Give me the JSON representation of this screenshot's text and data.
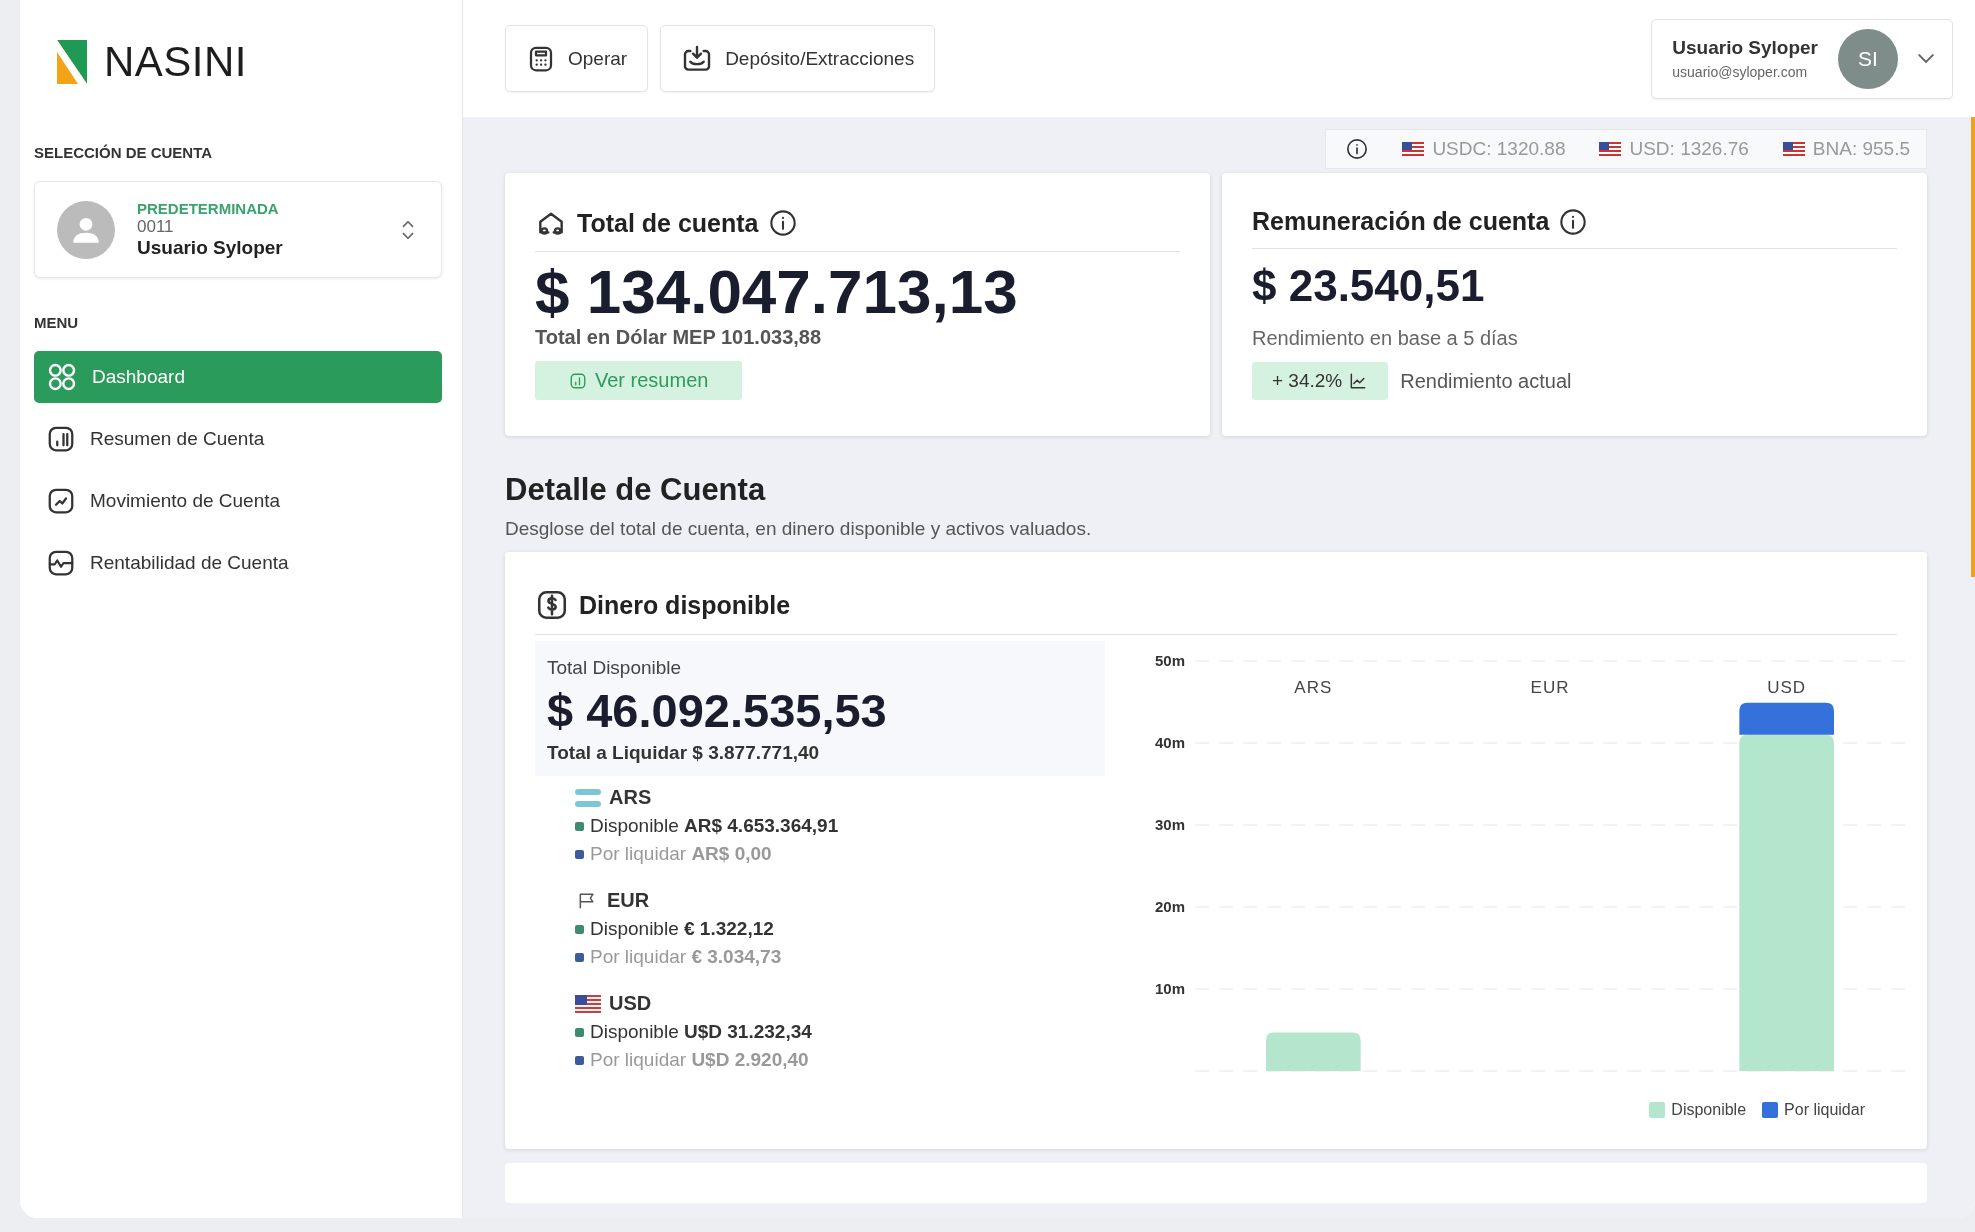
{
  "logo": {
    "text": "NASINI"
  },
  "account_selection": {
    "heading": "SELECCIÓN DE CUENTA",
    "badge": "PREDETERMINADA",
    "number": "0011",
    "name": "Usuario Syloper"
  },
  "menu": {
    "heading": "MENU",
    "items": [
      {
        "label": "Dashboard",
        "selected": true
      },
      {
        "label": "Resumen de Cuenta",
        "selected": false
      },
      {
        "label": "Movimiento de Cuenta",
        "selected": false
      },
      {
        "label": "Rentabilidad de Cuenta",
        "selected": false
      }
    ]
  },
  "toolbar": {
    "buttons": [
      "Operar",
      "Depósito/Extracciones"
    ]
  },
  "user": {
    "name": "Usuario Syloper",
    "email": "usuario@syloper.com",
    "initials": "SI"
  },
  "rates": [
    "USDC: 1320.88",
    "USD: 1326.76",
    "BNA: 955.5"
  ],
  "total_card": {
    "title": "Total de cuenta",
    "amount": "$ 134.047.713,13",
    "subtitle": "Total en Dólar MEP 101.033,88",
    "button": "Ver resumen"
  },
  "remuneration_card": {
    "title": "Remuneración de cuenta",
    "amount": "$ 23.540,51",
    "subtitle": "Rendimiento en base a 5 días",
    "badge": "+ 34.2%",
    "note": "Rendimiento actual"
  },
  "detail": {
    "title": "Detalle de Cuenta",
    "description": "Desglose del total de cuenta, en dinero disponible y activos valuados."
  },
  "available": {
    "title": "Dinero disponible",
    "total_label": "Total Disponible",
    "total_amount": "$ 46.092.535,53",
    "to_settle": "Total a Liquidar $ 3.877.771,40",
    "currencies": [
      {
        "code": "ARS",
        "available": "Disponible **AR$ 4.653.364,91**",
        "pending": "Por liquidar **AR$ 0,00**"
      },
      {
        "code": "EUR",
        "available": "Disponible **€ 1.322,12**",
        "pending": "Por liquidar **€ 3.034,73**"
      },
      {
        "code": "USD",
        "available": "Disponible **U$D 31.232,34**",
        "pending": "Por liquidar **U$D 2.920,40**"
      }
    ],
    "chart_data": {
      "type": "bar",
      "stacked": true,
      "grid": true,
      "legend": true,
      "categories": [
        "ARS",
        "EUR",
        "USD"
      ],
      "series": [
        {
          "name": "Disponible",
          "color": "#b3e6cc",
          "values": [
            4.7,
            0,
            41
          ]
        },
        {
          "name": "Por liquidar",
          "color": "#3571db",
          "values": [
            0,
            0,
            3.9
          ]
        }
      ],
      "ylim": [
        0,
        50
      ],
      "yticks": [
        {
          "value": 10,
          "label": "10m"
        },
        {
          "value": 20,
          "label": "20m"
        },
        {
          "value": 30,
          "label": "30m"
        },
        {
          "value": 40,
          "label": "40m"
        },
        {
          "value": 50,
          "label": "50m"
        }
      ]
    }
  }
}
